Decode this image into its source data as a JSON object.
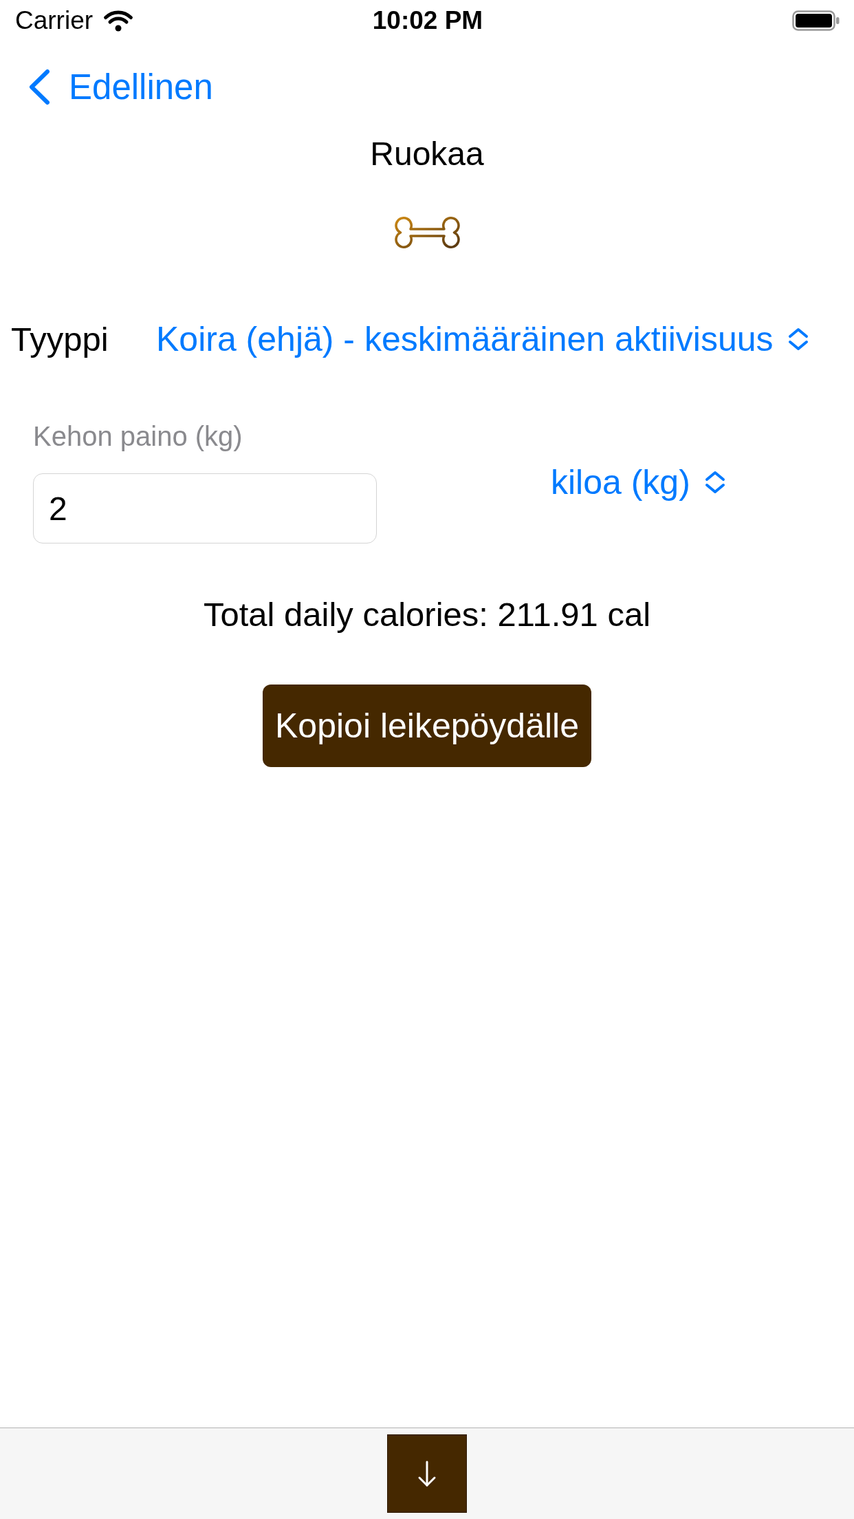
{
  "status_bar": {
    "carrier": "Carrier",
    "time": "10:02 PM"
  },
  "nav": {
    "back_label": "Edellinen",
    "title": "Ruokaa"
  },
  "type_row": {
    "label": "Tyyppi",
    "value": "Koira (ehjä) - keskimääräinen aktiivisuus"
  },
  "weight": {
    "label": "Kehon paino (kg)",
    "value": "2",
    "unit": "kiloa (kg)"
  },
  "total": "Total daily calories: 211.91 cal",
  "copy_button": "Kopioi leikepöydälle"
}
